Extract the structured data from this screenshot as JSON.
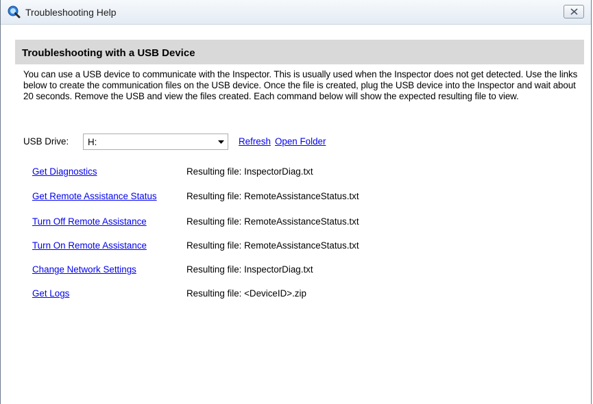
{
  "window": {
    "title": "Troubleshooting Help",
    "close_icon": "close-icon",
    "app_icon": "app-search-icon"
  },
  "section": {
    "heading": "Troubleshooting with a USB Device",
    "description": "You can use a USB device to communicate with the Inspector. This is usually used when the Inspector does not get detected. Use the links below to create the communication files on the USB device. Once the file is created, plug the USB device into the Inspector and wait about 20 seconds. Remove the USB and view the files created. Each command below will show the expected resulting file to view."
  },
  "usb": {
    "label": "USB Drive:",
    "selected_drive": "H:",
    "refresh_label": "Refresh",
    "open_folder_label": "Open Folder"
  },
  "commands": [
    {
      "label": "Get Diagnostics",
      "result": "Resulting file: InspectorDiag.txt"
    },
    {
      "label": "Get Remote Assistance Status",
      "result": "Resulting file: RemoteAssistanceStatus.txt"
    },
    {
      "label": "Turn Off Remote Assistance",
      "result": "Resulting file: RemoteAssistanceStatus.txt"
    },
    {
      "label": "Turn On Remote Assistance",
      "result": "Resulting file: RemoteAssistanceStatus.txt"
    },
    {
      "label": "Change Network Settings",
      "result": "Resulting file: InspectorDiag.txt"
    },
    {
      "label": "Get Logs",
      "result": "Resulting file: <DeviceID>.zip"
    }
  ],
  "colors": {
    "link": "#0000ee",
    "header_bar": "#d9d9d9",
    "titlebar_top": "#f6f9fc",
    "titlebar_bottom": "#e4ebf3"
  }
}
